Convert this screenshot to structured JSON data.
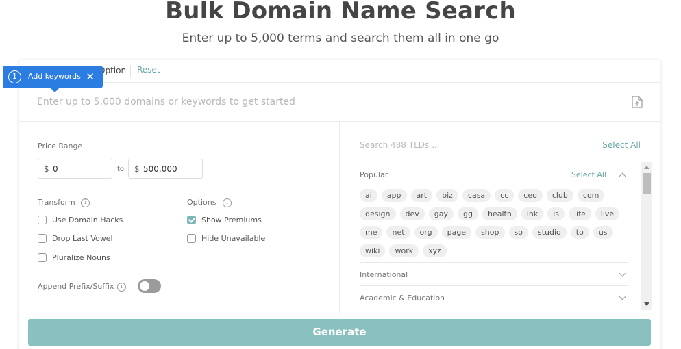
{
  "header": {
    "title": "Bulk Domain Name Search",
    "subtitle": "Enter up to 5,000 terms and search them all in one go"
  },
  "tooltip": {
    "step": "1",
    "text": "Add keywords",
    "close": "✕"
  },
  "topbar": {
    "option_label": "Option",
    "reset_label": "Reset"
  },
  "keywords": {
    "placeholder": "Enter up to 5,000 domains or keywords to get started",
    "upload_icon": "file-upload-icon"
  },
  "price": {
    "label": "Price Range",
    "currency": "$",
    "min": "0",
    "to": "to",
    "max": "500,000"
  },
  "transform": {
    "label": "Transform",
    "items": [
      {
        "label": "Use Domain Hacks",
        "checked": false
      },
      {
        "label": "Drop Last Vowel",
        "checked": false
      },
      {
        "label": "Pluralize Nouns",
        "checked": false
      }
    ]
  },
  "options": {
    "label": "Options",
    "items": [
      {
        "label": "Show Premiums",
        "checked": true
      },
      {
        "label": "Hide Unavailable",
        "checked": false
      }
    ]
  },
  "affix": {
    "label": "Append Prefix/Suffix",
    "enabled": false
  },
  "tlds": {
    "search_placeholder": "Search 488 TLDs ...",
    "select_all": "Select All",
    "groups": [
      {
        "name": "Popular",
        "select_all": "Select All",
        "expanded": true,
        "items": [
          "ai",
          "app",
          "art",
          "biz",
          "casa",
          "cc",
          "ceo",
          "club",
          "com",
          "design",
          "dev",
          "gay",
          "gg",
          "health",
          "ink",
          "is",
          "life",
          "live",
          "me",
          "net",
          "org",
          "page",
          "shop",
          "so",
          "studio",
          "to",
          "us",
          "wiki",
          "work",
          "xyz"
        ]
      },
      {
        "name": "International",
        "expanded": false
      },
      {
        "name": "Academic & Education",
        "expanded": false
      }
    ]
  },
  "generate_label": "Generate",
  "colors": {
    "accent": "#6aa5a8",
    "generate_bg": "#89c0c0",
    "tooltip_bg": "#2b7de1"
  }
}
